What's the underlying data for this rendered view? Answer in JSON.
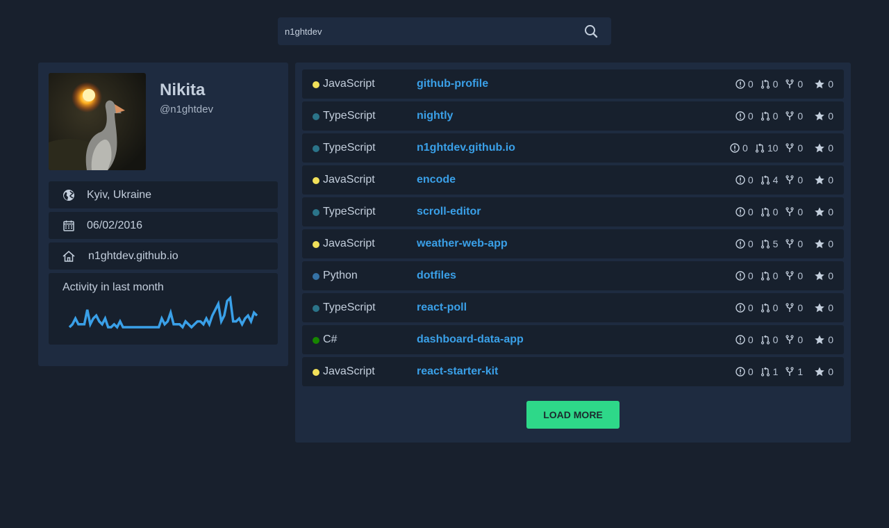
{
  "search": {
    "value": "n1ghtdev"
  },
  "profile": {
    "name": "Nikita",
    "login": "@n1ghtdev",
    "location": "Kyiv, Ukraine",
    "joined": "06/02/2016",
    "website": "n1ghtdev.github.io",
    "activity_title": "Activity in last month",
    "activity_values": [
      0,
      1,
      3,
      1,
      1,
      1,
      6,
      1,
      3,
      4,
      2,
      1,
      3,
      0,
      0,
      1,
      0,
      2,
      0,
      0,
      0,
      0,
      0,
      0,
      0,
      0,
      0,
      0,
      0,
      0,
      0,
      3,
      1,
      2,
      5,
      1,
      1,
      1,
      0,
      2,
      1,
      0,
      1,
      2,
      2,
      1,
      3,
      1,
      4,
      6,
      8,
      2,
      4,
      9,
      10,
      2,
      2,
      3,
      1,
      3,
      4,
      2,
      5,
      4
    ]
  },
  "colors": {
    "JavaScript": "#f1e05a",
    "TypeScript": "#2b7489",
    "Python": "#3572A5",
    "C#": "#178600",
    "accent": "#2ed889",
    "link": "#3aa0e8"
  },
  "repos": [
    {
      "lang": "JavaScript",
      "name": "github-profile",
      "issues": "0",
      "prs": "0",
      "forks": "0",
      "stars": "0"
    },
    {
      "lang": "TypeScript",
      "name": "nightly",
      "issues": "0",
      "prs": "0",
      "forks": "0",
      "stars": "0"
    },
    {
      "lang": "TypeScript",
      "name": "n1ghtdev.github.io",
      "issues": "0",
      "prs": "10",
      "forks": "0",
      "stars": "0"
    },
    {
      "lang": "JavaScript",
      "name": "encode",
      "issues": "0",
      "prs": "4",
      "forks": "0",
      "stars": "0"
    },
    {
      "lang": "TypeScript",
      "name": "scroll-editor",
      "issues": "0",
      "prs": "0",
      "forks": "0",
      "stars": "0"
    },
    {
      "lang": "JavaScript",
      "name": "weather-web-app",
      "issues": "0",
      "prs": "5",
      "forks": "0",
      "stars": "0"
    },
    {
      "lang": "Python",
      "name": "dotfiles",
      "issues": "0",
      "prs": "0",
      "forks": "0",
      "stars": "0"
    },
    {
      "lang": "TypeScript",
      "name": "react-poll",
      "issues": "0",
      "prs": "0",
      "forks": "0",
      "stars": "0"
    },
    {
      "lang": "C#",
      "name": "dashboard-data-app",
      "issues": "0",
      "prs": "0",
      "forks": "0",
      "stars": "0"
    },
    {
      "lang": "JavaScript",
      "name": "react-starter-kit",
      "issues": "0",
      "prs": "1",
      "forks": "1",
      "stars": "0"
    }
  ],
  "load_more_label": "LOAD MORE"
}
